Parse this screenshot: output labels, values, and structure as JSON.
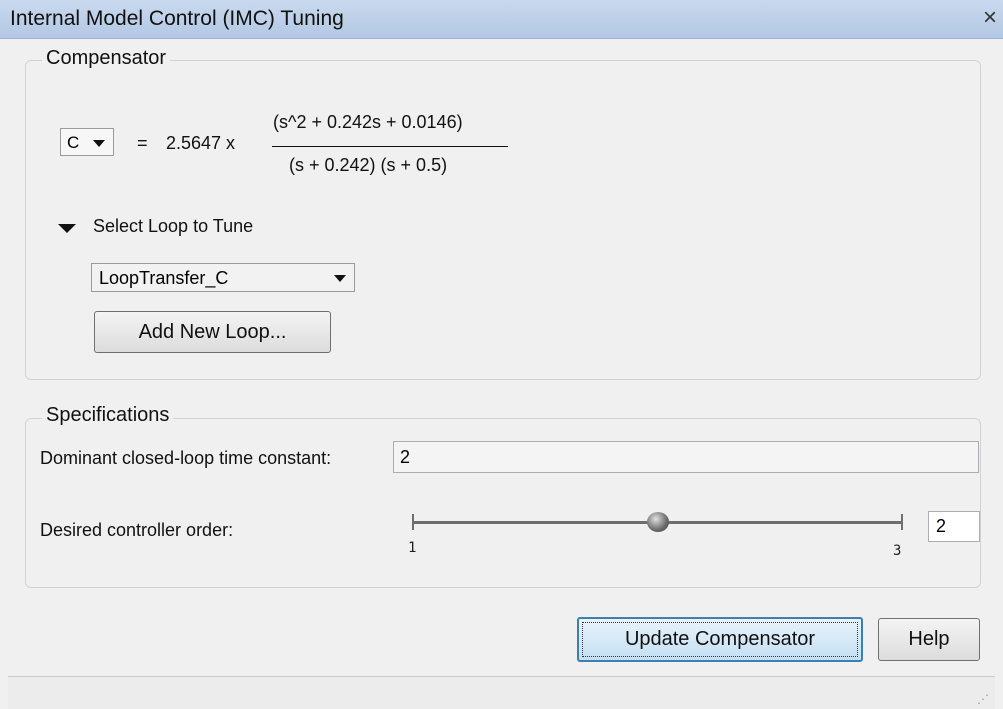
{
  "window": {
    "title": "Internal Model Control (IMC) Tuning",
    "close_glyph": "×"
  },
  "compensator": {
    "group_label": "Compensator",
    "selector_value": "C",
    "equals": "=",
    "gain": "2.5647 x",
    "numerator": "(s^2 + 0.242s + 0.0146)",
    "denominator": "(s + 0.242) (s + 0.5)",
    "loop_section_label": "Select Loop to Tune",
    "loop_selected": "LoopTransfer_C",
    "add_loop_label": "Add New Loop..."
  },
  "specifications": {
    "group_label": "Specifications",
    "time_constant_label": "Dominant closed-loop time constant:",
    "time_constant_value": "2",
    "order_label": "Desired controller order:",
    "order_min": "1",
    "order_max": "3",
    "order_value": "2",
    "slider_fraction": 0.5
  },
  "actions": {
    "update_label": "Update Compensator",
    "help_label": "Help"
  },
  "icons": {
    "combo_arrow": "chevron-down-icon",
    "section_toggle": "triangle-down-icon",
    "slider_knob": "slider-thumb-icon",
    "resize_grip": "resize-grip-icon"
  },
  "colors": {
    "titlebar": "#c9d9ee",
    "primary_button_border": "#3c7fb1",
    "background": "#f0f0f0"
  }
}
